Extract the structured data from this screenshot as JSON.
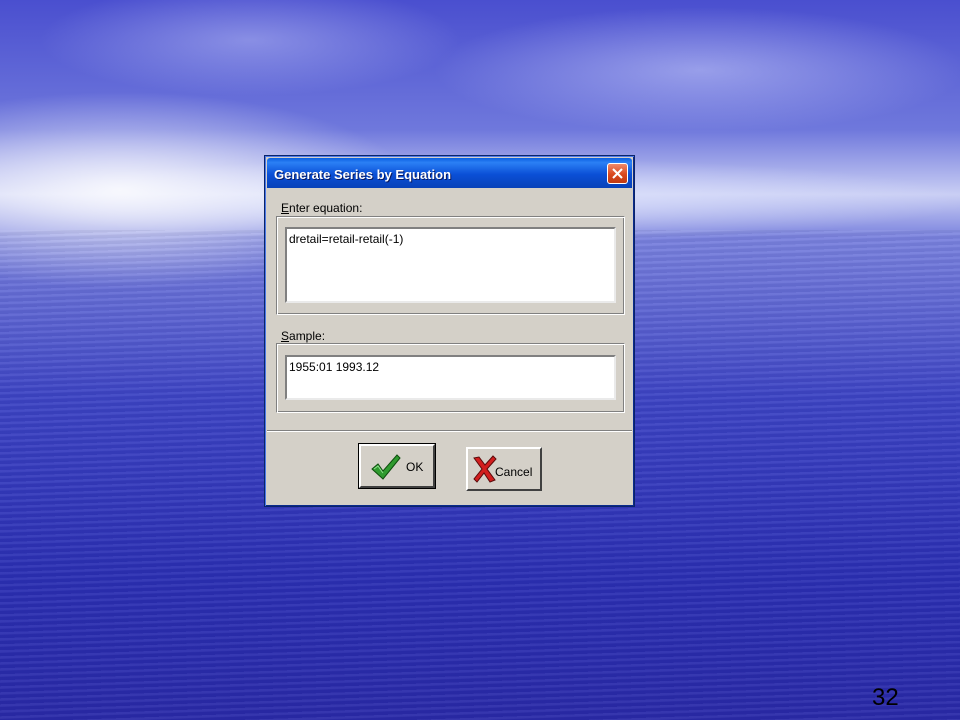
{
  "dialog": {
    "title": "Generate Series by Equation",
    "equation": {
      "label_mnemonic": "E",
      "label_rest": "nter equation:",
      "value": "dretail=retail-retail(-1)"
    },
    "sample": {
      "label_mnemonic": "S",
      "label_rest": "ample:",
      "value": "1955:01 1993.12"
    },
    "buttons": {
      "ok_label": "OK",
      "cancel_label": "Cancel"
    },
    "icons": {
      "close": "close-icon",
      "ok": "green-checkmark-icon",
      "cancel": "red-x-icon"
    }
  },
  "slide": {
    "number": "32"
  },
  "colors": {
    "titlebar": "#0a4fd6",
    "close_button": "#d9481e",
    "dialog_face": "#d4d0c8"
  }
}
